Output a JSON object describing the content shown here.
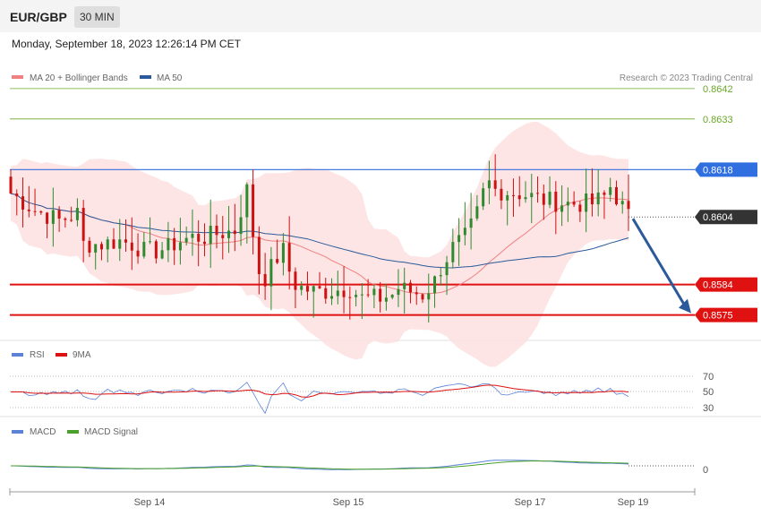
{
  "header": {
    "symbol": "EUR/GBP",
    "timeframe": "30 MIN",
    "datetime": "Monday, September 18, 2023 12:26:14 PM CET"
  },
  "legend": {
    "ma20": "MA 20 + Bollinger Bands",
    "ma50": "MA 50",
    "copyright": "Research © 2023 Trading Central"
  },
  "colors": {
    "ma20": "#f08080",
    "ma50": "#2a5a9a",
    "band_fill": "#fde0e0",
    "candle_up": "#2f8a2f",
    "candle_down": "#cc1111",
    "resistance": "#4a7de0",
    "support": "#e01111",
    "target": "#6aa82a",
    "arrow": "#2a5a9a"
  },
  "levels": [
    {
      "value": "0.8642",
      "kind": "target"
    },
    {
      "value": "0.8633",
      "kind": "target"
    },
    {
      "value": "0.8618",
      "kind": "resistance"
    },
    {
      "value": "0.8604",
      "kind": "current"
    },
    {
      "value": "0.8584",
      "kind": "support"
    },
    {
      "value": "0.8575",
      "kind": "support"
    }
  ],
  "rsi_panel": {
    "legend": [
      "RSI",
      "9MA"
    ],
    "ticks": [
      "70",
      "50",
      "30"
    ]
  },
  "macd_panel": {
    "legend": [
      "MACD",
      "MACD Signal"
    ],
    "ticks": [
      "0"
    ]
  },
  "xaxis": [
    "Sep 14",
    "Sep 15",
    "Sep 17",
    "Sep 19"
  ],
  "chart_data": {
    "type": "candlestick",
    "price_range": [
      0.8568,
      0.8647
    ],
    "key_levels": {
      "target_2": 0.8642,
      "target_1": 0.8633,
      "pivot": 0.8618,
      "last": 0.8604,
      "support_1": 0.8584,
      "support_2": 0.8575
    },
    "close_path": [
      [
        0,
        0.8611
      ],
      [
        4,
        0.8606
      ],
      [
        8,
        0.8603
      ],
      [
        11,
        0.8605
      ],
      [
        12,
        0.8596
      ],
      [
        15,
        0.8596
      ],
      [
        18,
        0.8597
      ],
      [
        20,
        0.8596
      ],
      [
        22,
        0.8594
      ],
      [
        24,
        0.8594
      ],
      [
        26,
        0.8595
      ],
      [
        28,
        0.8597
      ],
      [
        30,
        0.8598
      ],
      [
        32,
        0.8598
      ],
      [
        34,
        0.8599
      ],
      [
        37,
        0.86
      ],
      [
        38,
        0.8606
      ],
      [
        39,
        0.8612
      ],
      [
        40,
        0.8599
      ],
      [
        41,
        0.8588
      ],
      [
        42,
        0.8586
      ],
      [
        44,
        0.8592
      ],
      [
        45,
        0.8594
      ],
      [
        46,
        0.8588
      ],
      [
        47,
        0.8584
      ],
      [
        48,
        0.8583
      ],
      [
        50,
        0.8582
      ],
      [
        52,
        0.8582
      ],
      [
        56,
        0.8583
      ],
      [
        58,
        0.858
      ],
      [
        61,
        0.858
      ],
      [
        63,
        0.8581
      ],
      [
        64,
        0.8583
      ],
      [
        66,
        0.8582
      ],
      [
        68,
        0.8581
      ],
      [
        69,
        0.8583
      ],
      [
        70,
        0.8585
      ],
      [
        71,
        0.8589
      ],
      [
        72,
        0.8592
      ],
      [
        73,
        0.8595
      ],
      [
        75,
        0.8598
      ],
      [
        76,
        0.8601
      ],
      [
        77,
        0.8605
      ],
      [
        78,
        0.8611
      ],
      [
        79,
        0.8614
      ],
      [
        80,
        0.8612
      ],
      [
        84,
        0.8611
      ],
      [
        88,
        0.8609
      ],
      [
        92,
        0.8608
      ],
      [
        96,
        0.8608
      ],
      [
        98,
        0.861
      ],
      [
        99,
        0.8613
      ],
      [
        100,
        0.861
      ],
      [
        102,
        0.8604
      ]
    ],
    "forecast": {
      "from": 0.8604,
      "to": 0.8575
    }
  }
}
